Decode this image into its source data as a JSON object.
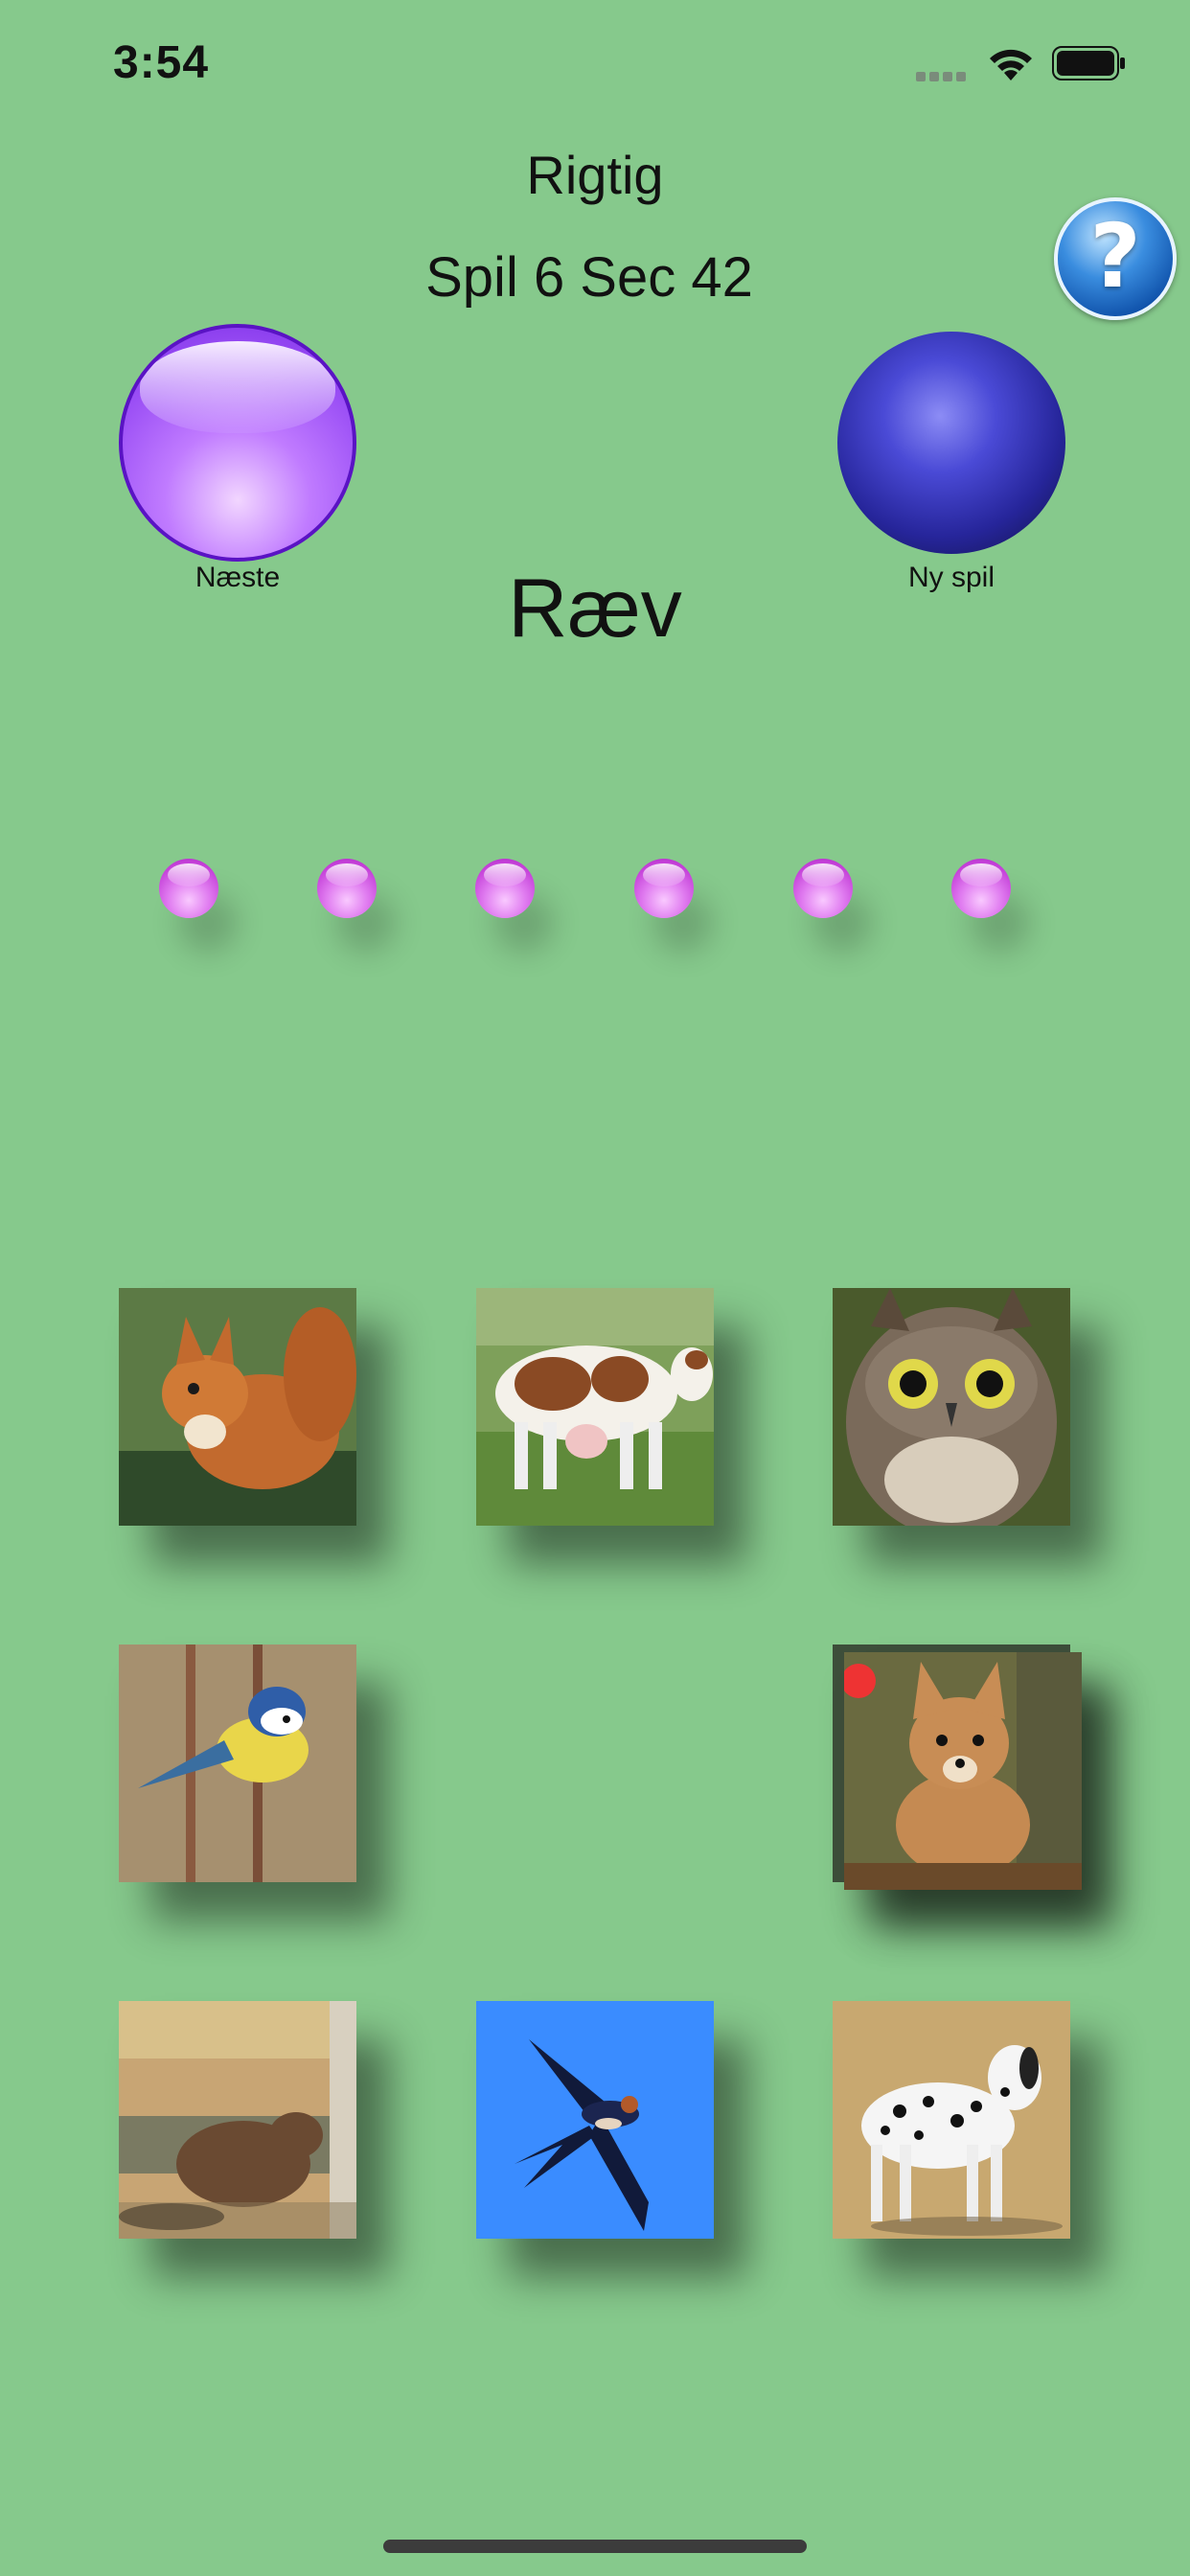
{
  "status_bar": {
    "time": "3:54"
  },
  "header": {
    "result": "Rigtig",
    "game_info": "Spil 6 Sec 42"
  },
  "buttons": {
    "next_label": "Næste",
    "new_game_label": "Ny spil",
    "help_symbol": "?"
  },
  "target_word": "Ræv",
  "progress": {
    "dots_count": 6
  },
  "tiles": [
    {
      "animal": "squirrel"
    },
    {
      "animal": "cow"
    },
    {
      "animal": "owl"
    },
    {
      "animal": "blue tit"
    },
    {
      "animal": "empty"
    },
    {
      "animal": "fox"
    },
    {
      "animal": "beaver"
    },
    {
      "animal": "swallow"
    },
    {
      "animal": "dalmatian"
    }
  ],
  "colors": {
    "background": "#86c98c",
    "next_button": "#a855f7",
    "new_game_button": "#2a2aa0",
    "progress_dot": "#d65ae8",
    "help_button": "#2a7ad6"
  }
}
